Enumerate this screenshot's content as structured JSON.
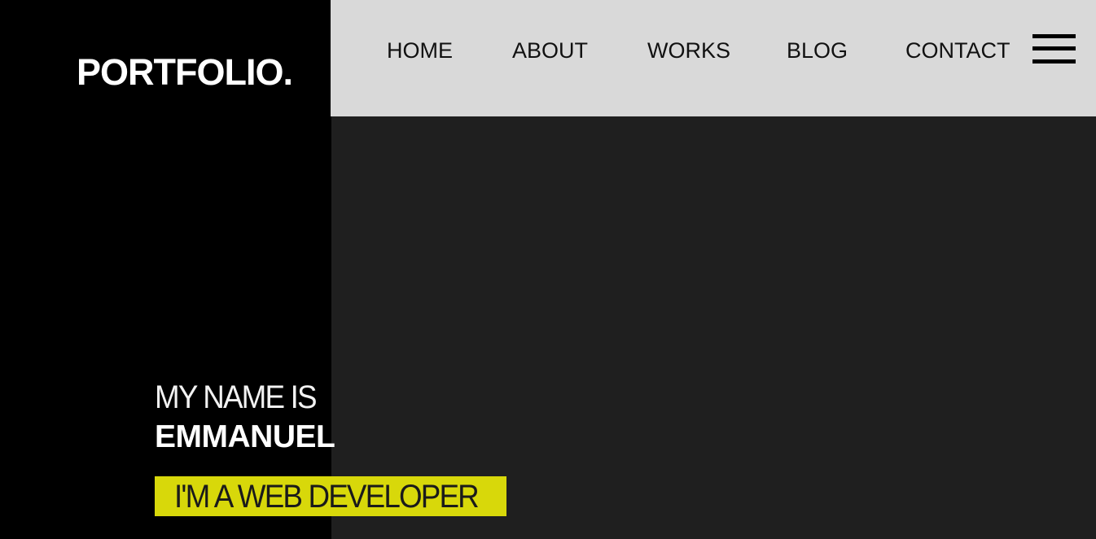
{
  "header": {
    "logo": "PORTFOLIO.",
    "nav": [
      {
        "label": "HOME"
      },
      {
        "label": "ABOUT"
      },
      {
        "label": "WORKS"
      },
      {
        "label": "BLOG"
      },
      {
        "label": "CONTACT"
      }
    ],
    "menu_icon": "hamburger-menu-icon"
  },
  "hero": {
    "intro": "MY NAME IS",
    "name": "EMMANUEL",
    "role": "I'M A WEB DEVELOPER"
  },
  "colors": {
    "left_panel": "#000000",
    "nav_bar": "#d9d9d9",
    "main_background": "#1f1f1f",
    "accent": "#d8d80a",
    "text_light": "#ffffff",
    "text_dark": "#111111"
  }
}
